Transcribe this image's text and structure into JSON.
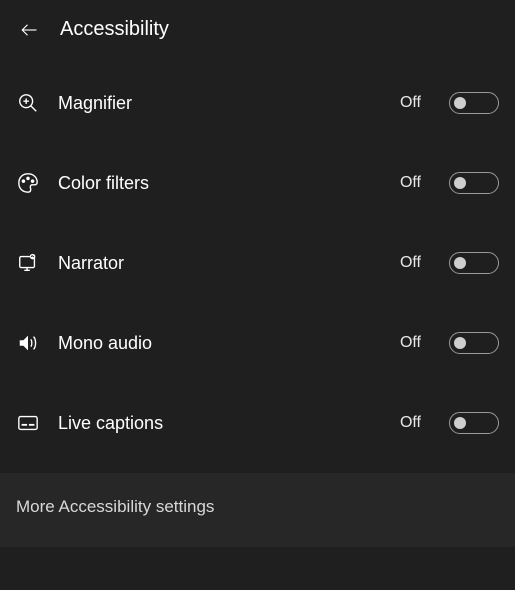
{
  "header": {
    "title": "Accessibility"
  },
  "settings": [
    {
      "icon": "magnifier-icon",
      "label": "Magnifier",
      "state": "Off"
    },
    {
      "icon": "color-filters-icon",
      "label": "Color filters",
      "state": "Off"
    },
    {
      "icon": "narrator-icon",
      "label": "Narrator",
      "state": "Off"
    },
    {
      "icon": "mono-audio-icon",
      "label": "Mono audio",
      "state": "Off"
    },
    {
      "icon": "live-captions-icon",
      "label": "Live captions",
      "state": "Off"
    }
  ],
  "footer": {
    "more_link": "More Accessibility settings"
  }
}
